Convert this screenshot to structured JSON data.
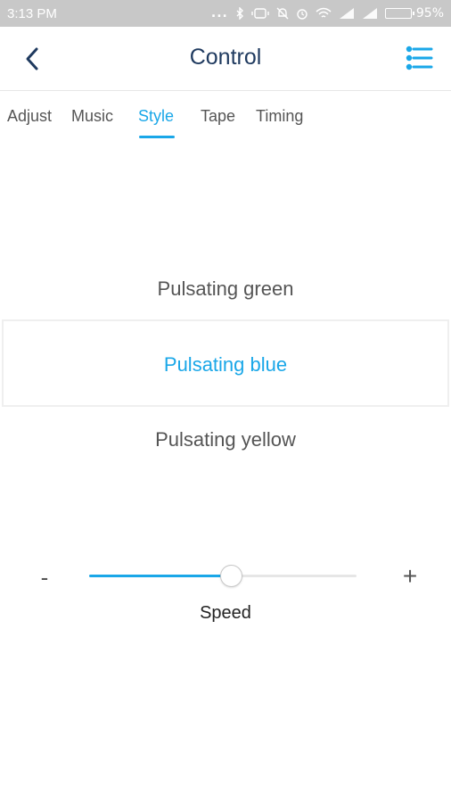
{
  "status_bar": {
    "time": "3:13 PM",
    "dots": "...",
    "battery_percent": "95%",
    "battery_level": 0.95,
    "icons": [
      "bluetooth-icon",
      "vibrate-icon",
      "mute-icon",
      "alarm-icon",
      "wifi-icon",
      "signal-icon",
      "signal-icon",
      "battery-icon"
    ]
  },
  "header": {
    "title": "Control",
    "back_icon": "chevron-left-icon",
    "menu_icon": "settings-list-icon"
  },
  "tabs": [
    {
      "label": "Adjust",
      "active": false
    },
    {
      "label": "Music",
      "active": false
    },
    {
      "label": "Style",
      "active": true
    },
    {
      "label": "Tape",
      "active": false
    },
    {
      "label": "Timing",
      "active": false
    }
  ],
  "styles": {
    "above": "Pulsating green",
    "selected": "Pulsating blue",
    "below": "Pulsating yellow"
  },
  "speed": {
    "label": "Speed",
    "minus": "-",
    "plus": "+",
    "value": 0.53
  },
  "colors": {
    "accent": "#1aa7e8",
    "title": "#1f3a5f",
    "status_bar": "#c8c8c8"
  }
}
